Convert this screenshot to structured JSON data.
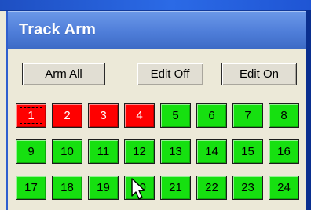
{
  "panel": {
    "title": "Track Arm"
  },
  "toolbar": {
    "arm_all_label": "Arm All",
    "edit_off_label": "Edit Off",
    "edit_on_label": "Edit On"
  },
  "tracks": [
    {
      "label": "1",
      "armed": true,
      "focused": true
    },
    {
      "label": "2",
      "armed": true,
      "focused": false
    },
    {
      "label": "3",
      "armed": true,
      "focused": false
    },
    {
      "label": "4",
      "armed": true,
      "focused": false
    },
    {
      "label": "5",
      "armed": false,
      "focused": false
    },
    {
      "label": "6",
      "armed": false,
      "focused": false
    },
    {
      "label": "7",
      "armed": false,
      "focused": false
    },
    {
      "label": "8",
      "armed": false,
      "focused": false
    },
    {
      "label": "9",
      "armed": false,
      "focused": false
    },
    {
      "label": "10",
      "armed": false,
      "focused": false
    },
    {
      "label": "11",
      "armed": false,
      "focused": false
    },
    {
      "label": "12",
      "armed": false,
      "focused": false
    },
    {
      "label": "13",
      "armed": false,
      "focused": false
    },
    {
      "label": "14",
      "armed": false,
      "focused": false
    },
    {
      "label": "15",
      "armed": false,
      "focused": false
    },
    {
      "label": "16",
      "armed": false,
      "focused": false
    },
    {
      "label": "17",
      "armed": false,
      "focused": false
    },
    {
      "label": "18",
      "armed": false,
      "focused": false
    },
    {
      "label": "19",
      "armed": false,
      "focused": false
    },
    {
      "label": "20",
      "armed": false,
      "focused": false
    },
    {
      "label": "21",
      "armed": false,
      "focused": false
    },
    {
      "label": "22",
      "armed": false,
      "focused": false
    },
    {
      "label": "23",
      "armed": false,
      "focused": false
    },
    {
      "label": "24",
      "armed": false,
      "focused": false
    }
  ],
  "colors": {
    "armed": "#ff0000",
    "unarmed": "#16e010"
  },
  "cursor": {
    "icon": "mouse-pointer-icon"
  }
}
